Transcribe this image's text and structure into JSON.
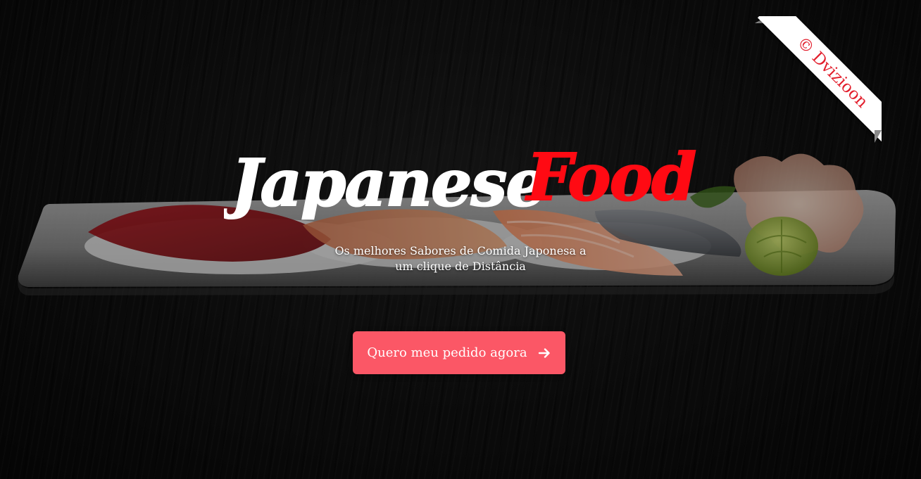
{
  "hero": {
    "title_part1": "Japanese",
    "title_part2": "Food",
    "subtitle_line1": "Os melhores Sabores de Comida Japonesa a",
    "subtitle_line2": "um clique de Distância",
    "cta_label": "Quero meu pedido agora",
    "cta_icon": "arrow-right-icon"
  },
  "ribbon": {
    "label": "© Dvizioon"
  },
  "colors": {
    "accent": "#fb5766",
    "title_red": "#ff0a13",
    "ribbon_text": "#e21d2b",
    "background": "#0b0b0b"
  }
}
